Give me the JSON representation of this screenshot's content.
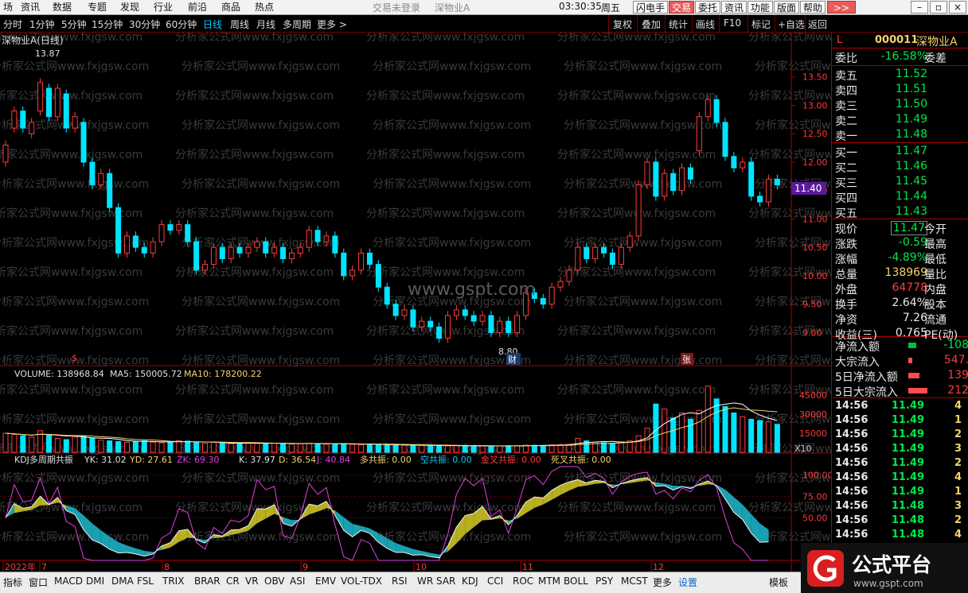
{
  "menu": {
    "items": [
      "场",
      "资讯",
      "数据",
      "专题",
      "发现",
      "行业",
      "前沿",
      "商品",
      "热点"
    ],
    "status": "交易未登录",
    "security": "深物业A",
    "time": "03:30:35",
    "weekday": "周五",
    "buttons": [
      "闪电手",
      "交易",
      "委托",
      "资讯",
      "功能",
      "版面",
      "帮助",
      ">>"
    ]
  },
  "periods": {
    "items": [
      "分时",
      "1分钟",
      "5分钟",
      "15分钟",
      "30分钟",
      "60分钟",
      "日线",
      "周线",
      "月线",
      "多周期",
      "更多 >"
    ],
    "active": "日线"
  },
  "tools": [
    "复权",
    "叠加",
    "统计",
    "画线",
    "F10",
    "标记",
    "+自选",
    "返回"
  ],
  "price_pane": {
    "title": "深物业A(日线)",
    "high_label": "13.87",
    "low_label": "8.80",
    "last_label": "11.40",
    "watermark_center": "www.gspt.com",
    "watermark_text": "分析家公式网www.fxjgsw.com",
    "markers": {
      "s": "$",
      "cai": "财",
      "zhang": "张"
    }
  },
  "volume_pane": {
    "label_vol": "VOLUME: 138968.84",
    "label_ma5": "MA5: 150005.72",
    "label_ma10": "MA10: 178200.22",
    "x10": "X10"
  },
  "kdj_pane": {
    "title": "KDJ多周期共振",
    "yk": "YK: 31.02",
    "yd": "YD: 27.61",
    "zk": "ZK: 69.30",
    "k": "K: 37.97",
    "d": "D: 36.54",
    "j": "J: 40.84",
    "duo": "多共振: 0.00",
    "kong": "空共振: 0.00",
    "jin": "金叉共振: 0.00",
    "si": "死叉共振: 0.00"
  },
  "timeline": {
    "labels": [
      "2022年",
      "7",
      "8",
      "9",
      "10",
      "11",
      "12"
    ]
  },
  "bottom_tabs": [
    "指标",
    "窗口",
    "MACD",
    "DMI",
    "DMA",
    "FSL",
    "TRIX",
    "BRAR",
    "CR",
    "VR",
    "OBV",
    "ASI",
    "EMV",
    "VOL-TDX",
    "RSI",
    "WR",
    "SAR",
    "KDJ",
    "CCI",
    "ROC",
    "MTM",
    "BOLL",
    "PSY",
    "MCST",
    "更多",
    "设置",
    "模板"
  ],
  "bottom_active": "设置",
  "quote": {
    "code": "000011",
    "name": "深物业A",
    "flag": "L",
    "weibi_label": "委比",
    "weibi": "-16.58%",
    "weicha_label": "委差",
    "asks": [
      {
        "label": "卖五",
        "price": "11.52"
      },
      {
        "label": "卖四",
        "price": "11.51"
      },
      {
        "label": "卖三",
        "price": "11.50"
      },
      {
        "label": "卖二",
        "price": "11.49"
      },
      {
        "label": "卖一",
        "price": "11.48"
      }
    ],
    "bids": [
      {
        "label": "买一",
        "price": "11.47"
      },
      {
        "label": "买二",
        "price": "11.46"
      },
      {
        "label": "买三",
        "price": "11.45"
      },
      {
        "label": "买四",
        "price": "11.44"
      },
      {
        "label": "买五",
        "price": "11.43"
      }
    ],
    "stats": [
      {
        "l": "现价",
        "v": "11.47",
        "r": "今开",
        "c": "g"
      },
      {
        "l": "涨跌",
        "v": "-0.59",
        "r": "最高",
        "c": "g"
      },
      {
        "l": "涨幅",
        "v": "-4.89%",
        "r": "最低",
        "c": "g"
      },
      {
        "l": "总量",
        "v": "138969",
        "r": "量比",
        "c": "y"
      },
      {
        "l": "外盘",
        "v": "64778",
        "r": "内盘",
        "c": "rd"
      },
      {
        "l": "换手",
        "v": "2.64%",
        "r": "股本",
        "c": "w"
      },
      {
        "l": "净资",
        "v": "7.26",
        "r": "流通",
        "c": "w"
      },
      {
        "l": "收益(三)",
        "v": "0.765",
        "r": "PE(动)",
        "c": "w"
      }
    ],
    "flows": [
      {
        "l": "净流入额",
        "v": "-108",
        "c": "g"
      },
      {
        "l": "大宗流入",
        "v": "547.",
        "c": "rd"
      },
      {
        "l": "5日净流入额",
        "v": "139",
        "c": "rd"
      },
      {
        "l": "5日大宗流入",
        "v": "212",
        "c": "rd"
      }
    ],
    "ticks": [
      {
        "t": "14:56",
        "p": "11.49",
        "n": "4"
      },
      {
        "t": "14:56",
        "p": "11.49",
        "n": "1"
      },
      {
        "t": "14:56",
        "p": "11.49",
        "n": "2"
      },
      {
        "t": "14:56",
        "p": "11.49",
        "n": "3"
      },
      {
        "t": "14:56",
        "p": "11.49",
        "n": "2"
      },
      {
        "t": "14:56",
        "p": "11.49",
        "n": "4"
      },
      {
        "t": "14:56",
        "p": "11.49",
        "n": "1"
      },
      {
        "t": "14:56",
        "p": "11.48",
        "n": "3"
      },
      {
        "t": "14:56",
        "p": "11.48",
        "n": "2"
      },
      {
        "t": "14:56",
        "p": "11.48",
        "n": "4"
      }
    ]
  },
  "brand": {
    "logo_text": "公式平台",
    "url": "www.gspt.com"
  },
  "chart_data": [
    {
      "type": "candlestick",
      "title": "深物业A(日线)",
      "y_ticks": [
        9.0,
        9.5,
        10.0,
        10.5,
        11.0,
        11.5,
        12.0,
        12.5,
        13.0,
        13.5
      ],
      "ylim": [
        8.6,
        14.0
      ],
      "high": 13.87,
      "low": 8.8,
      "last": 11.4,
      "close": [
        12.3,
        12.9,
        12.6,
        12.7,
        13.4,
        12.8,
        13.3,
        12.6,
        12.8,
        12.0,
        11.6,
        11.8,
        11.2,
        10.4,
        10.7,
        10.5,
        10.4,
        10.6,
        10.9,
        10.8,
        10.9,
        10.6,
        10.1,
        10.2,
        10.5,
        10.3,
        10.5,
        10.4,
        10.5,
        10.6,
        10.4,
        10.5,
        10.3,
        10.4,
        10.5,
        10.8,
        10.6,
        10.7,
        10.4,
        10.0,
        10.1,
        10.4,
        10.2,
        9.8,
        9.5,
        9.3,
        9.4,
        9.1,
        9.2,
        9.1,
        8.9,
        9.3,
        9.4,
        9.3,
        9.2,
        9.3,
        9.0,
        9.2,
        9.0,
        9.3,
        9.7,
        9.6,
        9.5,
        9.8,
        9.9,
        10.1,
        10.5,
        10.3,
        10.5,
        10.4,
        10.2,
        10.5,
        10.7,
        11.6,
        12.0,
        11.4,
        11.8,
        11.5,
        11.9,
        11.7,
        12.8,
        13.1,
        12.7,
        12.1,
        11.9,
        12.0,
        11.4,
        11.3,
        11.7,
        11.6,
        11.8,
        12.0,
        11.4
      ],
      "open": [
        12.0,
        12.6,
        12.9,
        12.5,
        12.9,
        13.3,
        12.8,
        13.2,
        12.6,
        12.7,
        12.0,
        11.6,
        11.8,
        11.2,
        10.4,
        10.7,
        10.5,
        10.4,
        10.6,
        10.9,
        10.8,
        10.9,
        10.6,
        10.1,
        10.2,
        10.5,
        10.3,
        10.5,
        10.4,
        10.5,
        10.6,
        10.4,
        10.5,
        10.3,
        10.4,
        10.5,
        10.8,
        10.6,
        10.7,
        10.4,
        10.0,
        10.1,
        10.4,
        10.2,
        9.8,
        9.5,
        9.3,
        9.4,
        9.1,
        9.2,
        9.1,
        8.9,
        9.3,
        9.4,
        9.3,
        9.2,
        9.3,
        9.0,
        9.2,
        9.0,
        9.3,
        9.7,
        9.6,
        9.5,
        9.8,
        9.9,
        10.1,
        10.5,
        10.3,
        10.5,
        10.4,
        10.2,
        10.5,
        10.7,
        11.6,
        12.0,
        11.4,
        11.8,
        11.5,
        11.9,
        12.2,
        12.8,
        13.1,
        12.7,
        12.1,
        11.9,
        12.0,
        11.4,
        11.3,
        11.7,
        11.6,
        11.8,
        11.9
      ]
    },
    {
      "type": "bar",
      "title": "VOLUME",
      "y_ticks": [
        15000,
        30000,
        45000
      ],
      "ylim": [
        0,
        55000
      ],
      "series": [
        {
          "name": "VOLUME",
          "values": [
            15000,
            14000,
            13000,
            12000,
            17000,
            14000,
            11000,
            10000,
            12000,
            13000,
            11000,
            9500,
            9000,
            8500,
            8000,
            8600,
            9000,
            8000,
            7500,
            8000,
            9200,
            8800,
            7500,
            7000,
            7800,
            7200,
            6800,
            7000,
            7400,
            7100,
            6900,
            7200,
            6700,
            6500,
            6800,
            7100,
            6700,
            6400,
            6600,
            6900,
            6200,
            6000,
            6300,
            6100,
            5800,
            5600,
            5500,
            5700,
            5400,
            5200,
            5300,
            5000,
            5200,
            5100,
            4900,
            5100,
            4800,
            5000,
            5200,
            5300,
            5600,
            5500,
            5400,
            5800,
            6000,
            6400,
            11000,
            9000,
            8000,
            7600,
            7200,
            8200,
            9000,
            13000,
            19000,
            38000,
            34000,
            27000,
            31000,
            26000,
            33000,
            52000,
            42000,
            36000,
            31000,
            28000,
            26000,
            25000,
            24000,
            22000,
            24000,
            21000,
            14000
          ]
        },
        {
          "name": "MA5",
          "values": [
            150005.72
          ]
        },
        {
          "name": "MA10",
          "values": [
            178200.22
          ]
        }
      ]
    },
    {
      "type": "line",
      "title": "KDJ多周期共振",
      "y_ticks": [
        50,
        75,
        100
      ],
      "ylim": [
        0,
        110
      ],
      "series": [
        {
          "name": "K",
          "last": 37.97
        },
        {
          "name": "D",
          "last": 36.54
        },
        {
          "name": "J",
          "last": 40.84
        },
        {
          "name": "YK",
          "last": 31.02
        },
        {
          "name": "YD",
          "last": 27.61
        },
        {
          "name": "ZK",
          "last": 69.3
        }
      ]
    }
  ]
}
